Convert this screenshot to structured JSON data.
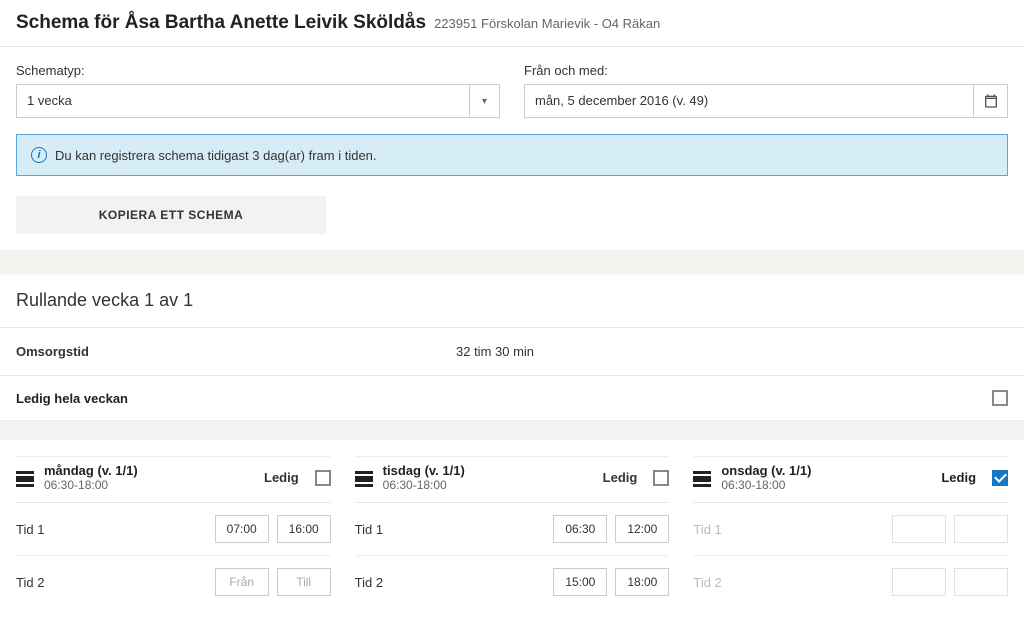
{
  "header": {
    "title": "Schema för Åsa Bartha Anette Leivik Sköldås",
    "subtitle": "223951 Förskolan Marievik - O4 Räkan"
  },
  "form": {
    "schematyp_label": "Schematyp:",
    "schematyp_value": "1 vecka",
    "from_label": "Från och med:",
    "from_value": "mån, 5 december 2016 (v. 49)"
  },
  "info": {
    "text": "Du kan registrera schema tidigast 3 dag(ar) fram i tiden."
  },
  "buttons": {
    "copy": "KOPIERA ETT SCHEMA"
  },
  "week": {
    "title": "Rullande vecka 1 av 1",
    "omsorgstid_label": "Omsorgstid",
    "omsorgstid_value": "32 tim 30 min",
    "ledig_hela_label": "Ledig hela veckan"
  },
  "labels": {
    "ledig": "Ledig",
    "tid1": "Tid 1",
    "tid2": "Tid 2",
    "from_ph": "Från",
    "till_ph": "Till"
  },
  "days": [
    {
      "title": "måndag (v. 1/1)",
      "range": "06:30-18:00",
      "ledig": false,
      "t1a": "07:00",
      "t1b": "16:00",
      "t2a": "",
      "t2b": ""
    },
    {
      "title": "tisdag (v. 1/1)",
      "range": "06:30-18:00",
      "ledig": false,
      "t1a": "06:30",
      "t1b": "12:00",
      "t2a": "15:00",
      "t2b": "18:00"
    },
    {
      "title": "onsdag (v. 1/1)",
      "range": "06:30-18:00",
      "ledig": true,
      "t1a": "",
      "t1b": "",
      "t2a": "",
      "t2b": ""
    }
  ]
}
